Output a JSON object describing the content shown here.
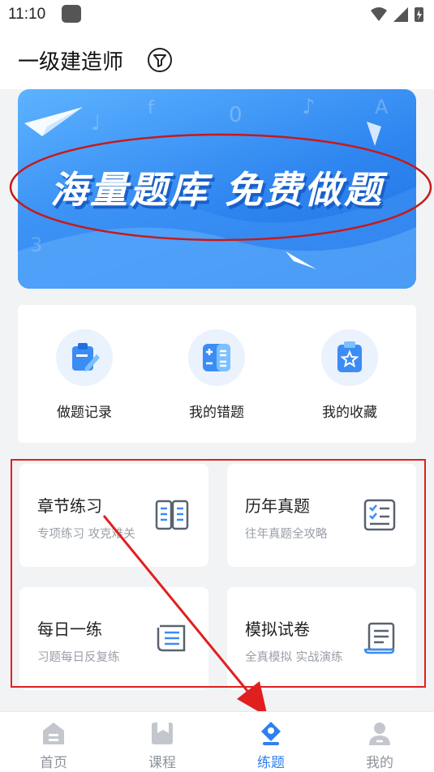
{
  "status_bar": {
    "time": "11:10"
  },
  "header": {
    "title": "一级建造师"
  },
  "banner": {
    "text": "海量题库  免费做题"
  },
  "quick_access": [
    {
      "label": "做题记录",
      "icon": "pencil-note-icon"
    },
    {
      "label": "我的错题",
      "icon": "calculator-icon"
    },
    {
      "label": "我的收藏",
      "icon": "star-bookmark-icon"
    }
  ],
  "practice_cards": [
    {
      "title": "章节练习",
      "subtitle": "专项练习 攻克难关",
      "icon": "open-book-icon"
    },
    {
      "title": "历年真题",
      "subtitle": "往年真题全攻略",
      "icon": "checklist-icon"
    },
    {
      "title": "每日一练",
      "subtitle": "习题每日反复练",
      "icon": "notebook-icon"
    },
    {
      "title": "模拟试卷",
      "subtitle": "全真模拟 实战演练",
      "icon": "scroll-paper-icon"
    }
  ],
  "bottom_nav": [
    {
      "label": "首页",
      "icon": "home-icon",
      "active": false
    },
    {
      "label": "课程",
      "icon": "course-icon",
      "active": false
    },
    {
      "label": "练题",
      "icon": "pen-tip-icon",
      "active": true
    },
    {
      "label": "我的",
      "icon": "user-icon",
      "active": false
    }
  ],
  "colors": {
    "accent": "#2f7ff0",
    "annotation": "#e02020",
    "banner": "#2f86f0"
  }
}
